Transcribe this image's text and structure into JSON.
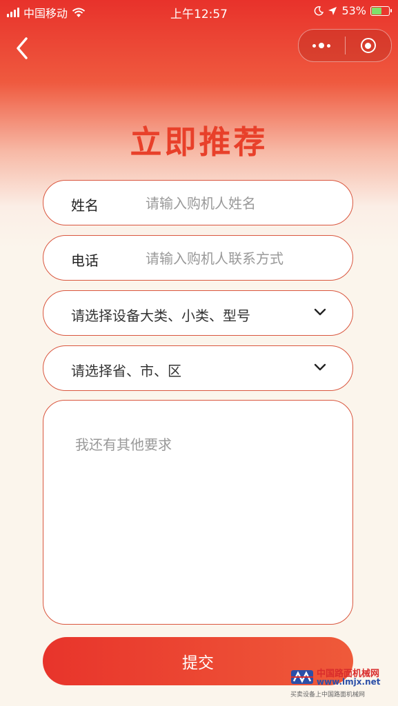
{
  "status_bar": {
    "carrier": "中国移动",
    "time": "上午12:57",
    "battery_percent": "53%",
    "battery_level": 0.53,
    "icons": [
      "signal-bars-icon",
      "wifi-icon",
      "moon-icon",
      "location-arrow-icon",
      "battery-icon"
    ]
  },
  "nav": {
    "back_icon": "chevron-left-icon",
    "capsule_icons": [
      "more-dots-icon",
      "close-target-icon"
    ]
  },
  "page": {
    "title": "立即推荐"
  },
  "form": {
    "name": {
      "label": "姓名",
      "placeholder": "请输入购机人姓名",
      "value": ""
    },
    "phone": {
      "label": "电话",
      "placeholder": "请输入购机人联系方式",
      "value": ""
    },
    "equipment_select": {
      "text": "请选择设备大类、小类、型号",
      "icon": "chevron-down-icon"
    },
    "region_select": {
      "text": "请选择省、市、区",
      "icon": "chevron-down-icon"
    },
    "remarks": {
      "placeholder": "我还有其他要求",
      "value": ""
    },
    "submit_label": "提交"
  },
  "watermark": {
    "line1": "中国路面机械网",
    "line2": "www.lmjx.net",
    "line3": "买卖设备上中国路面机械网"
  },
  "colors": {
    "accent": "#e8402a",
    "border": "#d9553d",
    "page_bg": "#fbf5ec",
    "header_red": "#e8322b"
  }
}
